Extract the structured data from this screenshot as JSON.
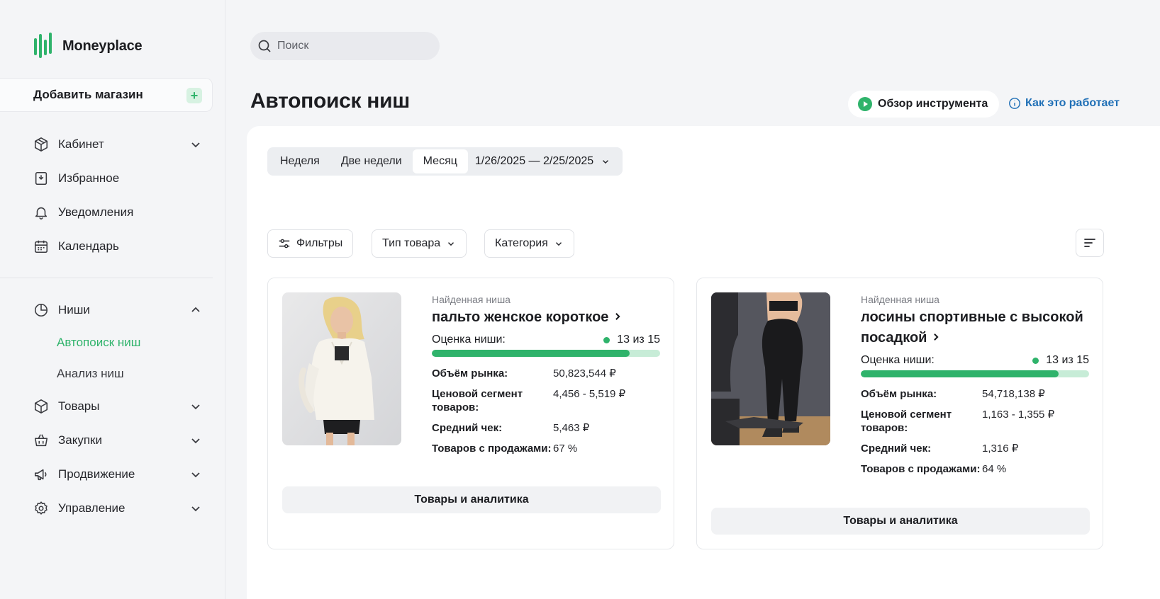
{
  "app": {
    "name": "Moneyplace"
  },
  "sidebar": {
    "add_store": "Добавить магазин",
    "items": [
      {
        "label": "Кабинет",
        "icon": "box-icon",
        "expand": "down"
      },
      {
        "label": "Избранное",
        "icon": "bookmark-icon"
      },
      {
        "label": "Уведомления",
        "icon": "bell-icon"
      },
      {
        "label": "Календарь",
        "icon": "calendar-icon"
      }
    ],
    "section2": [
      {
        "label": "Ниши",
        "icon": "pie-chart-icon",
        "expand": "up"
      },
      {
        "label": "Товары",
        "icon": "package-icon",
        "expand": "down"
      },
      {
        "label": "Закупки",
        "icon": "basket-icon",
        "expand": "down"
      },
      {
        "label": "Продвижение",
        "icon": "megaphone-icon",
        "expand": "down"
      },
      {
        "label": "Управление",
        "icon": "settings-icon",
        "expand": "down"
      }
    ],
    "niches_sub": [
      {
        "label": "Автопоиск ниш",
        "active": true
      },
      {
        "label": "Анализ ниш",
        "active": false
      }
    ]
  },
  "search": {
    "placeholder": "Поиск"
  },
  "header": {
    "title": "Автопоиск ниш",
    "overview_button": "Обзор инструмента",
    "howto_link": "Как это работает"
  },
  "period": {
    "options": [
      "Неделя",
      "Две недели",
      "Месяц"
    ],
    "selected": "Месяц",
    "date_range": "1/26/2025 — 2/25/2025"
  },
  "filters": {
    "filters_label": "Фильтры",
    "type_label": "Тип товара",
    "category_label": "Категория"
  },
  "cards": [
    {
      "found_label": "Найденная ниша",
      "title": "пальто женское короткое",
      "score_label": "Оценка ниши:",
      "score_text": "13 из 15",
      "score": 13,
      "score_max": 15,
      "stats": [
        {
          "k": "Объём рынка:",
          "v": "50,823,544 ₽"
        },
        {
          "k": "Ценовой сегмент товаров:",
          "v": "4,456 - 5,519 ₽"
        },
        {
          "k": "Средний чек:",
          "v": "5,463 ₽"
        },
        {
          "k": "Товаров с продажами:",
          "v": "67 %"
        }
      ],
      "button": "Товары и аналитика"
    },
    {
      "found_label": "Найденная ниша",
      "title": "лосины спортивные с высокой посадкой",
      "score_label": "Оценка ниши:",
      "score_text": "13 из 15",
      "score": 13,
      "score_max": 15,
      "stats": [
        {
          "k": "Объём рынка:",
          "v": "54,718,138 ₽"
        },
        {
          "k": "Ценовой сегмент товаров:",
          "v": "1,163 - 1,355 ₽"
        },
        {
          "k": "Средний чек:",
          "v": "1,316 ₽"
        },
        {
          "k": "Товаров с продажами:",
          "v": "64 %"
        }
      ],
      "button": "Товары и аналитика"
    }
  ],
  "colors": {
    "accent": "#2fb36b",
    "link": "#1f6fb6"
  }
}
